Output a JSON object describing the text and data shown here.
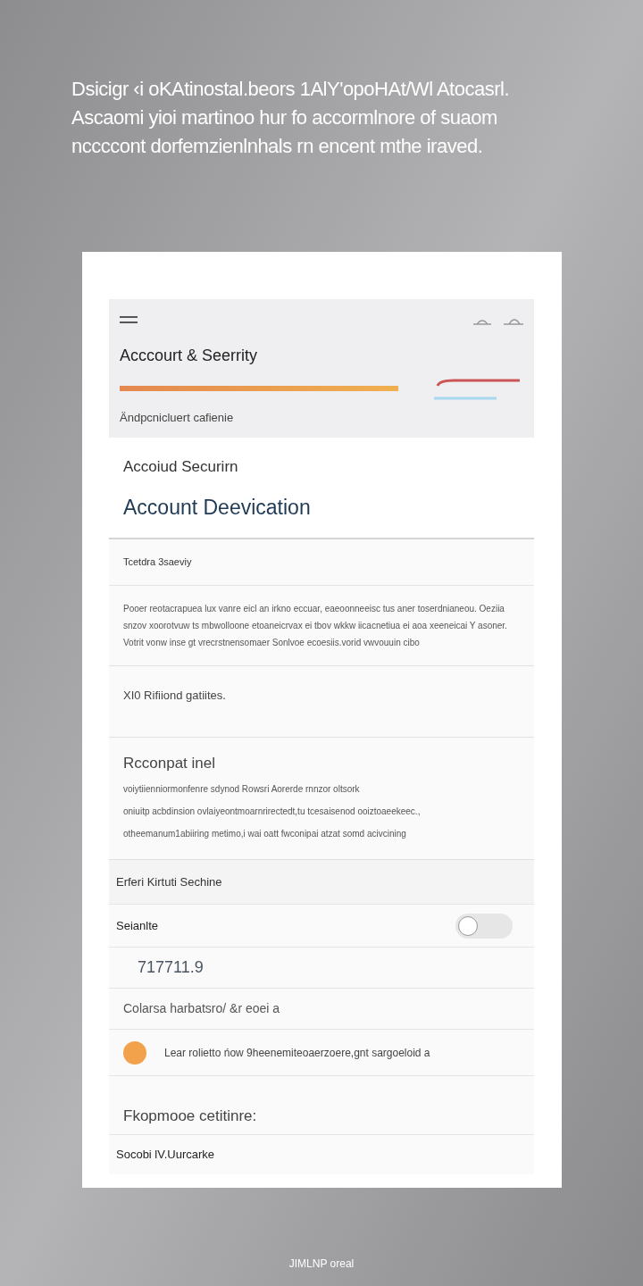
{
  "intro": {
    "lines": [
      "Dsicigr ‹i oKAtinostal.beors 1AlY'opoHAt/Wl Atocasrl.",
      "Ascaomi yioi martinoo hur fo accormlnore of suaom",
      "nccccont dorfemzienlnhals rn encent mthe iraved."
    ]
  },
  "app": {
    "header": {
      "title": "Acccourt & Seerrity",
      "subtitle": "Ändpcnicluert cafienie"
    },
    "section": {
      "label": "Accoiud Securirn",
      "title": "Account Deevication"
    },
    "notice": {
      "title": "Tcetdra 3saeviy",
      "body": "Pooer reotacrapuea lux vanre eicl an irkno eccuar, eaeoonneeisc tus aner toserdnianeou. Oeziia snzov xoorotvuw ts mbwolloone etoaneicrvax ei tbov wkkw iicacnetiua ei aoa xeeneicai Y asoner. Votrit vonw inse gt vrecrstnensomaer Sonlvoe ecoesiis.vorid vwvouuin cibo"
    },
    "limit": {
      "title": "XI0 Rifiiond gatiites."
    },
    "recovery": {
      "title": "Rcconpat inel",
      "lines": [
        "voiytiienniormonfenre sdynod Rowsri Aorerde rnnzor oltsork",
        "oniuitp acbdinsion ovlaiyeontmoarnrirectedt,tu tcesaisenod ooiztoaeekeec.,",
        "otheemanum1abiiring metimo,i wai oatt fwconipai atzat somd acivcining"
      ]
    },
    "rows": [
      {
        "kind": "heading",
        "label": "Erferi Kirtuti Sechine"
      },
      {
        "kind": "toggle",
        "label": "Seianlte",
        "on": false
      },
      {
        "kind": "value",
        "label": "717711.9"
      },
      {
        "kind": "plain",
        "label": "Colarsa harbatsro/ &r eoei a"
      },
      {
        "kind": "dot",
        "label": "Lear rolietto ńow 9heenemiteoaerzoere,gnt sargoeloid a",
        "color": "#f2a24a"
      }
    ],
    "footer": {
      "title": "Fkopmooe cetitinre:",
      "item": "Socobi lV.Uurcarke"
    }
  },
  "caption": "JIMLNP oreal"
}
